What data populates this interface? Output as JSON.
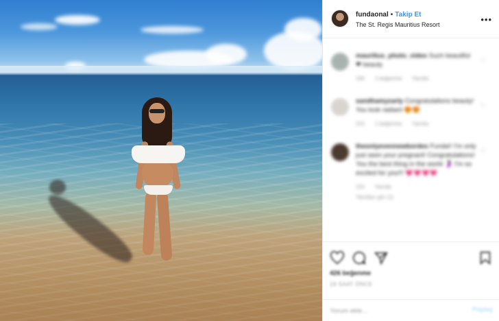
{
  "post": {
    "username": "fundaonal",
    "separator": "•",
    "follow_label": "Takip Et",
    "location": "The St. Regis Mauritius Resort",
    "more_icon": "more-horizontal-icon"
  },
  "colors": {
    "follow_link": "#3897f0",
    "text": "#262626",
    "muted": "#999999"
  },
  "comments": [
    {
      "username": "maurilius_photo_video",
      "text": "Such beautiful ❤ beauty",
      "meta_time": "19h",
      "meta_likes": "1 beğenme",
      "meta_reply": "Yanıtla",
      "avatar_color": "#a8b3b0"
    },
    {
      "username": "sandhamyzarty",
      "text": "Congratulations beauty! You look radiant 😍😍",
      "meta_time": "21h",
      "meta_likes": "1 beğenme",
      "meta_reply": "Yanıtla",
      "avatar_color": "#d9d4cf"
    },
    {
      "username": "theonlyevennewbordes",
      "text": "Funda!! I'm only just seen your pregnant! Congratulations! You the best thing in the world 🤰🏻 I'm so excited for you!!! 💗💗💗💗",
      "meta_time": "21h",
      "meta_likes": "",
      "meta_reply": "Yanıtla",
      "meta_extra": "Yanıtları gör (1)",
      "avatar_color": "#4a3a30"
    }
  ],
  "actions": {
    "like_icon": "heart-icon",
    "comment_icon": "comment-icon",
    "share_icon": "share-icon",
    "save_icon": "bookmark-icon",
    "likes_text": "426 beğenme",
    "time_text": "18 SAAT ÖNCE"
  },
  "add_comment": {
    "placeholder": "Yorum ekle...",
    "post_label": "Paylaş"
  }
}
